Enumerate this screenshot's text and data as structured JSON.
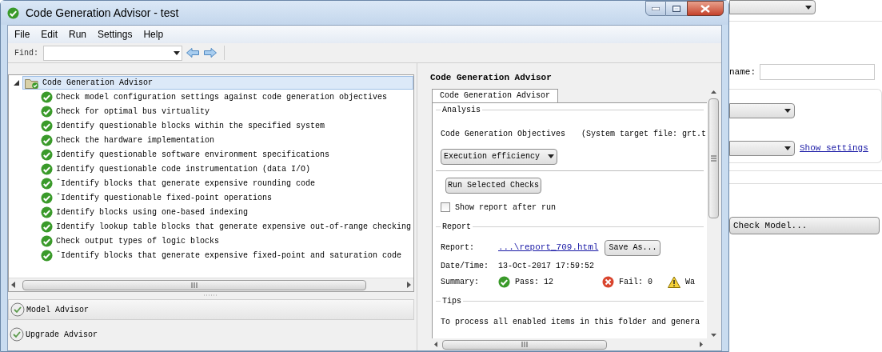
{
  "window": {
    "title": "Code Generation Advisor - test"
  },
  "menu": [
    "File",
    "Edit",
    "Run",
    "Settings",
    "Help"
  ],
  "toolbar": {
    "find_label": "Find:"
  },
  "tree": {
    "label": "Code Generation Advisor",
    "expanded": true,
    "selected": true,
    "children": [
      {
        "label": "Check model configuration settings against code generation objectives",
        "kind": "passed"
      },
      {
        "label": "Check for optimal bus virtuality",
        "kind": "passed"
      },
      {
        "label": "Identify questionable blocks within the specified system",
        "kind": "passed"
      },
      {
        "label": "Check the hardware implementation",
        "kind": "passed"
      },
      {
        "label": "Identify questionable software environment specifications",
        "kind": "passed"
      },
      {
        "label": "Identify questionable code instrumentation (data I/O)",
        "kind": "passed"
      },
      {
        "label": "ˆIdentify blocks that generate expensive rounding code",
        "kind": "passed"
      },
      {
        "label": "ˆIdentify questionable fixed-point operations",
        "kind": "passed"
      },
      {
        "label": "Identify blocks using one-based indexing",
        "kind": "passed"
      },
      {
        "label": "Identify lookup table blocks that generate expensive out-of-range checking",
        "kind": "passed"
      },
      {
        "label": "Check output types of logic blocks",
        "kind": "passed"
      },
      {
        "label": "ˆIdentify blocks that generate expensive fixed-point and saturation code",
        "kind": "passed"
      }
    ]
  },
  "advisors": [
    {
      "label": "Model Advisor"
    },
    {
      "label": "Upgrade Advisor"
    }
  ],
  "details": {
    "heading": "Code Generation Advisor",
    "tab": {
      "label": "Code Generation Advisor",
      "selected": true
    },
    "analysis": {
      "title": "Analysis",
      "objectives_label": "Code Generation Objectives",
      "target_file": "(System target file:  grt.t",
      "objective": "Execution efficiency",
      "run_button": "Run Selected Checks",
      "show_report": {
        "label": "Show report after run",
        "checked": false
      }
    },
    "report": {
      "title": "Report",
      "report_label": "Report:",
      "report_link": "...\\report_709.html",
      "save_button": "Save As...",
      "datetime_label": "Date/Time:",
      "datetime": "13-Oct-2017 17:59:52",
      "summary_label": "Summary:",
      "summary": [
        {
          "kind": "pass",
          "text": "Pass: 12"
        },
        {
          "kind": "fail",
          "text": "Fail: 0"
        },
        {
          "kind": "warn",
          "text": "Wa"
        }
      ]
    },
    "tips": {
      "title": "Tips",
      "text": "To process all enabled items in this folder and genera"
    }
  },
  "background_window": {
    "name_label": "name:",
    "link": "Show settings",
    "button": "Check Model..."
  }
}
